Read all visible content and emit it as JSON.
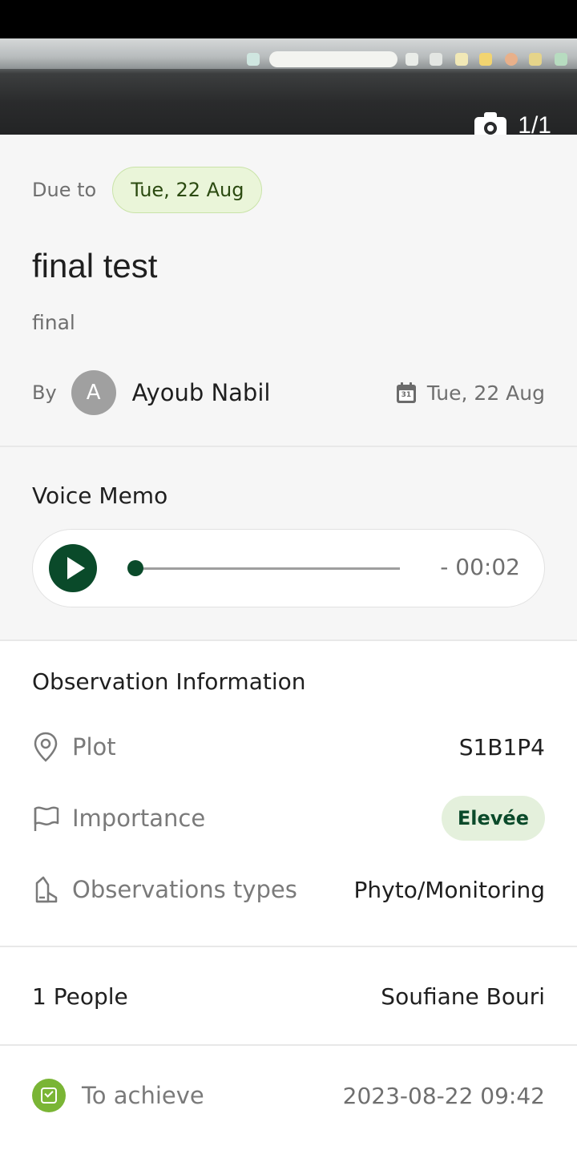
{
  "photo": {
    "counter": "1/1"
  },
  "task": {
    "due_label": "Due to",
    "due_date": "Tue, 22 Aug",
    "title": "final test",
    "subtitle": "final",
    "by_label": "By",
    "avatar_initial": "A",
    "author": "Ayoub Nabil",
    "created_date": "Tue, 22 Aug",
    "calendar_day": "31"
  },
  "voice_memo": {
    "title": "Voice Memo",
    "time": "- 00:02",
    "progress": 0
  },
  "observation": {
    "title": "Observation Information",
    "rows": [
      {
        "label": "Plot",
        "value": "S1B1P4",
        "icon": "location-pin-icon"
      },
      {
        "label": "Importance",
        "value": "Elevée",
        "icon": "flag-icon"
      },
      {
        "label": "Observations types",
        "value": "Phyto/Monitoring",
        "icon": "plant-tag-icon"
      }
    ]
  },
  "people": {
    "count_label": "1 People",
    "name": "Soufiane Bouri"
  },
  "status": {
    "label": "To achieve",
    "datetime": "2023-08-22 09:42"
  },
  "colors": {
    "accent": "#0a4a2a",
    "due_chip_bg": "#eaf5d9",
    "importance_chip_bg": "#e4f0dc",
    "status_green": "#7ab535"
  }
}
